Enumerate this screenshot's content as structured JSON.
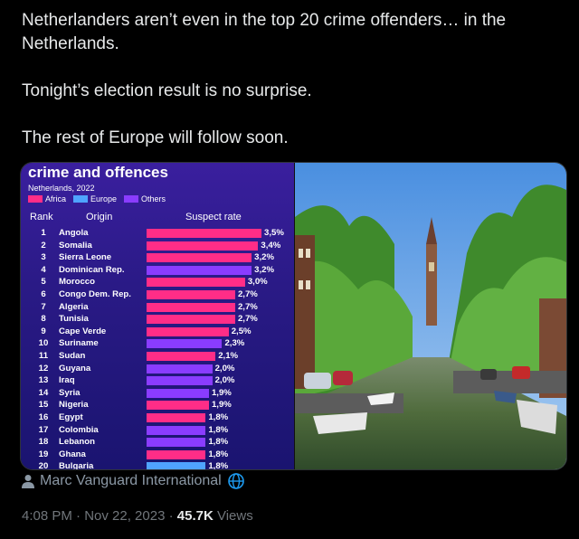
{
  "tweet": {
    "lines": [
      "Netherlanders aren’t even in the top 20 crime offenders… in the Netherlands.",
      "Tonight’s election result is no surprise.",
      "The rest of Europe will follow soon."
    ],
    "author": "Marc Vanguard International",
    "timestamp": "4:08 PM · Nov 22, 2023 ·",
    "views_count": "45.7K",
    "views_label": "Views"
  },
  "infographic": {
    "title": "crime and offences",
    "subtitle": "Netherlands, 2022",
    "legend": [
      {
        "label": "Africa",
        "color": "#ff2d87"
      },
      {
        "label": "Europe",
        "color": "#4fa3ff"
      },
      {
        "label": "Others",
        "color": "#8a3cff"
      }
    ],
    "columns": {
      "rank": "Rank",
      "origin": "Origin",
      "rate": "Suspect rate"
    }
  },
  "chart_data": {
    "type": "bar",
    "title": "crime and offences",
    "subtitle": "Netherlands, 2022",
    "xlabel": "Suspect rate",
    "categories": [
      "Angola",
      "Somalia",
      "Sierra Leone",
      "Dominican Rep.",
      "Morocco",
      "Congo Dem. Rep.",
      "Algeria",
      "Tunisia",
      "Cape Verde",
      "Suriname",
      "Sudan",
      "Guyana",
      "Iraq",
      "Syria",
      "Nigeria",
      "Egypt",
      "Colombia",
      "Lebanon",
      "Ghana",
      "Bulgaria"
    ],
    "ranks": [
      "1",
      "2",
      "3",
      "4",
      "5",
      "6",
      "7",
      "8",
      "9",
      "10",
      "11",
      "12",
      "13",
      "14",
      "15",
      "16",
      "17",
      "18",
      "19",
      "20"
    ],
    "values": [
      3.5,
      3.4,
      3.2,
      3.2,
      3.0,
      2.7,
      2.7,
      2.7,
      2.5,
      2.3,
      2.1,
      2.0,
      2.0,
      1.9,
      1.9,
      1.8,
      1.8,
      1.8,
      1.8,
      1.8
    ],
    "labels": [
      "3,5%",
      "3,4%",
      "3,2%",
      "3,2%",
      "3,0%",
      "2,7%",
      "2,7%",
      "2,7%",
      "2,5%",
      "2,3%",
      "2,1%",
      "2,0%",
      "2,0%",
      "1,9%",
      "1,9%",
      "1,8%",
      "1,8%",
      "1,8%",
      "1,8%",
      "1,8%"
    ],
    "groups": [
      "Africa",
      "Africa",
      "Africa",
      "Others",
      "Africa",
      "Africa",
      "Africa",
      "Africa",
      "Africa",
      "Others",
      "Africa",
      "Others",
      "Others",
      "Others",
      "Africa",
      "Africa",
      "Others",
      "Others",
      "Africa",
      "Europe"
    ],
    "group_colors": {
      "Africa": "#ff2d87",
      "Europe": "#4fa3ff",
      "Others": "#8a3cff"
    },
    "xlim": [
      0,
      3.5
    ]
  }
}
